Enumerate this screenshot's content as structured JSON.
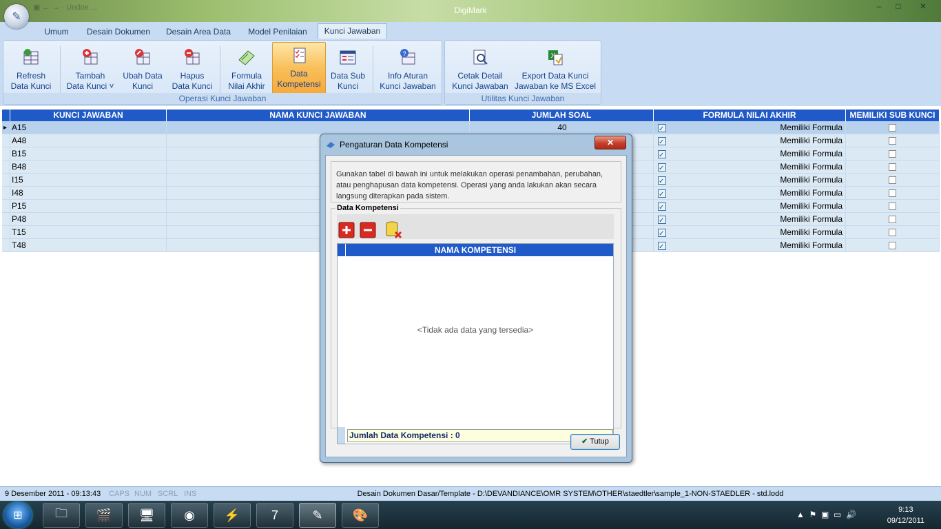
{
  "window": {
    "title": "DigiMark",
    "quick_access": "▣ ← → ·  Undoe  ...",
    "min_label": "–",
    "max_label": "□",
    "close_label": "✕"
  },
  "tabs": [
    {
      "label": "Umum"
    },
    {
      "label": "Desain Dokumen"
    },
    {
      "label": "Desain Area Data"
    },
    {
      "label": "Model Penilaian"
    },
    {
      "label": "Kunci Jawaban"
    }
  ],
  "ribbon": {
    "group1_label": "Operasi Kunci Jawaban",
    "group2_label": "Utilitas Kunci Jawaban",
    "buttons": [
      {
        "line1": "Refresh",
        "line2": "Data Kunci"
      },
      {
        "line1": "Tambah",
        "line2": "Data Kunci ˅"
      },
      {
        "line1": "Ubah Data",
        "line2": "Kunci"
      },
      {
        "line1": "Hapus",
        "line2": "Data Kunci"
      },
      {
        "line1": "Formula",
        "line2": "Nilai Akhir"
      },
      {
        "line1": "Data",
        "line2": "Kompetensi"
      },
      {
        "line1": "Data Sub",
        "line2": "Kunci"
      },
      {
        "line1": "Info Aturan",
        "line2": "Kunci Jawaban"
      },
      {
        "line1": "Cetak Detail",
        "line2": "Kunci Jawaban"
      },
      {
        "line1": "Export Data Kunci",
        "line2": "Jawaban ke MS Excel"
      }
    ]
  },
  "grid": {
    "headers": [
      "KUNCI JAWABAN",
      "NAMA KUNCI JAWABAN",
      "JUMLAH SOAL",
      "FORMULA NILAI AKHIR",
      "MEMILIKI SUB KUNCI"
    ],
    "rows": [
      {
        "kunci": "A15",
        "nama": "",
        "jumlah": "40",
        "formula": "Memiliki Formula",
        "sub": false
      },
      {
        "kunci": "A48",
        "nama": "",
        "jumlah": "",
        "formula": "Memiliki Formula",
        "sub": false
      },
      {
        "kunci": "B15",
        "nama": "",
        "jumlah": "",
        "formula": "Memiliki Formula",
        "sub": false
      },
      {
        "kunci": "B48",
        "nama": "",
        "jumlah": "",
        "formula": "Memiliki Formula",
        "sub": false
      },
      {
        "kunci": "I15",
        "nama": "",
        "jumlah": "",
        "formula": "Memiliki Formula",
        "sub": false
      },
      {
        "kunci": "I48",
        "nama": "",
        "jumlah": "",
        "formula": "Memiliki Formula",
        "sub": false
      },
      {
        "kunci": "P15",
        "nama": "",
        "jumlah": "",
        "formula": "Memiliki Formula",
        "sub": false
      },
      {
        "kunci": "P48",
        "nama": "",
        "jumlah": "",
        "formula": "Memiliki Formula",
        "sub": false
      },
      {
        "kunci": "T15",
        "nama": "",
        "jumlah": "",
        "formula": "Memiliki Formula",
        "sub": false
      },
      {
        "kunci": "T48",
        "nama": "",
        "jumlah": "",
        "formula": "Memiliki Formula",
        "sub": false
      }
    ]
  },
  "dialog": {
    "title": "Pengaturan Data Kompetensi",
    "close_label": "✕",
    "description": "Gunakan tabel di bawah ini untuk melakukan operasi penambahan, perubahan, atau penghapusan data kompetensi. Operasi yang anda lakukan akan secara langsung diterapkan pada sistem.",
    "fieldset_label": "Data Kompetensi",
    "column_header": "NAMA KOMPETENSI",
    "empty_text": "<Tidak ada data yang tersedia>",
    "footer_text": "Jumlah Data Kompetensi : 0",
    "close_button": "Tutup",
    "check_glyph": "✔"
  },
  "status": {
    "datetime": "9 Desember 2011 - 09:13:43",
    "caps": "CAPS",
    "num": "NUM",
    "scrl": "SCRL",
    "ins": "INS",
    "path": "Desain Dokumen Dasar/Template - D:\\DEVANDIANCE\\OMR SYSTEM\\OTHER\\staedtler\\sample_1-NON-STAEDLER - std.lodd"
  },
  "taskbar": {
    "time": "9:13",
    "date": "09/12/2011"
  },
  "colors": {
    "header_blue": "#1f5ac8",
    "ribbon_bg": "#c7dcf2",
    "active_button": "#f9bf5a"
  }
}
